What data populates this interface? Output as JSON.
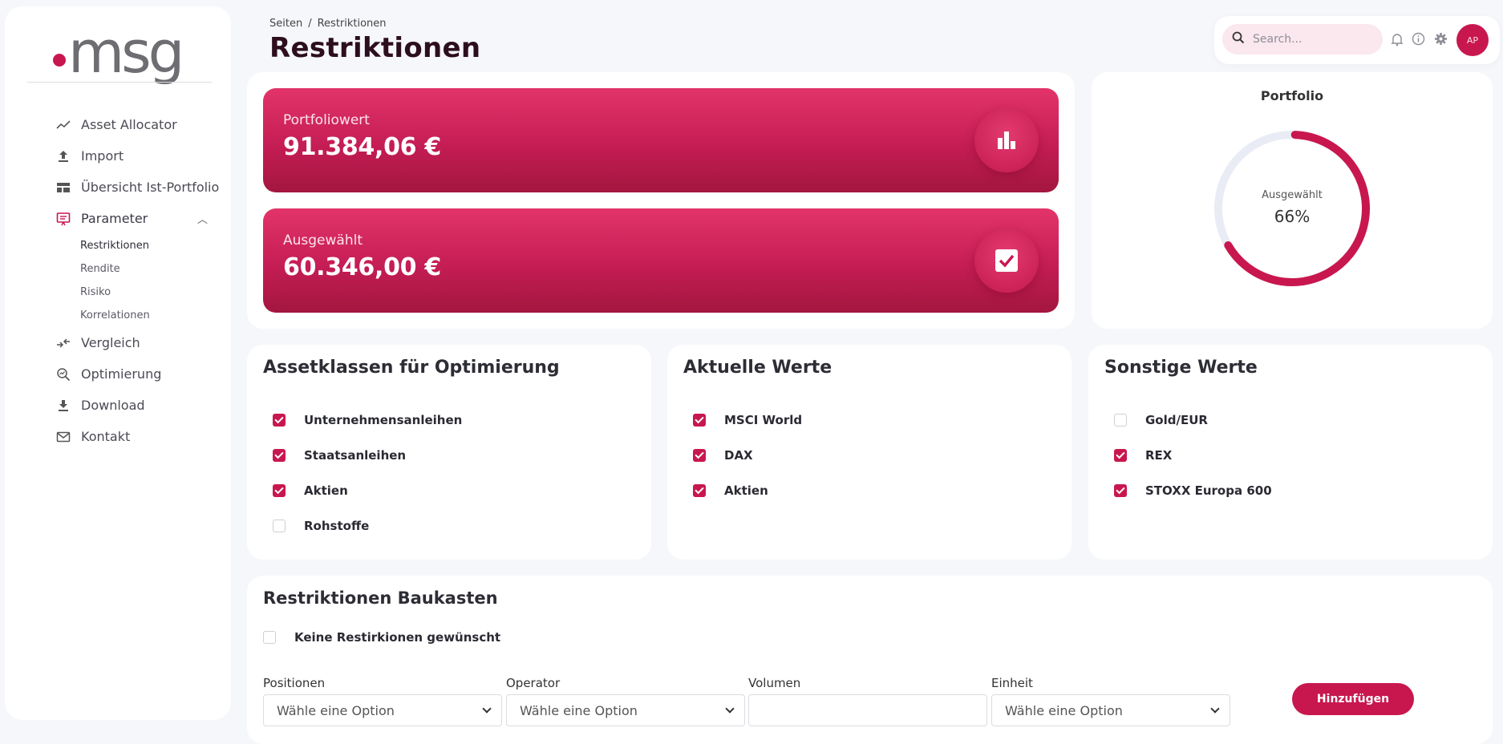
{
  "logo": {
    "text": "msg"
  },
  "sidebar": {
    "items": [
      {
        "label": "Asset Allocator",
        "icon": "trend-line-icon"
      },
      {
        "label": "Import",
        "icon": "upload-icon"
      },
      {
        "label": "Übersicht Ist-Portfolio",
        "icon": "dashboard-icon"
      },
      {
        "label": "Parameter",
        "icon": "presentation-icon",
        "expanded": true
      },
      {
        "label": "Vergleich",
        "icon": "compare-arrows-icon"
      },
      {
        "label": "Optimierung",
        "icon": "search-analytics-icon"
      },
      {
        "label": "Download",
        "icon": "download-icon"
      },
      {
        "label": "Kontakt",
        "icon": "mail-icon"
      }
    ],
    "subitems": [
      {
        "label": "Restriktionen",
        "active": true
      },
      {
        "label": "Rendite"
      },
      {
        "label": "Risiko"
      },
      {
        "label": "Korrelationen"
      }
    ]
  },
  "breadcrumb": {
    "root": "Seiten",
    "separator": "/",
    "current": "Restriktionen"
  },
  "page_title": "Restriktionen",
  "topbar": {
    "search_placeholder": "Search...",
    "avatar_initials": "AP",
    "icons": [
      "bell-icon",
      "info-icon",
      "gear-icon"
    ]
  },
  "kpis": [
    {
      "label": "Portfoliowert",
      "value": "91.384,06 €",
      "icon": "bar-chart-icon"
    },
    {
      "label": "Ausgewählt",
      "value": "60.346,00 €",
      "icon": "checkbox-icon"
    }
  ],
  "donut": {
    "title": "Portfolio",
    "label": "Ausgewählt",
    "value": "66%",
    "fraction": 0.66,
    "color": "#c8174f",
    "track_color": "#e9ecf5"
  },
  "cards": [
    {
      "title": "Assetklassen für Optimierung",
      "items": [
        {
          "label": "Unternehmensanleihen",
          "checked": true
        },
        {
          "label": "Staatsanleihen",
          "checked": true
        },
        {
          "label": "Aktien",
          "checked": true
        },
        {
          "label": "Rohstoffe",
          "checked": false
        }
      ]
    },
    {
      "title": "Aktuelle Werte",
      "items": [
        {
          "label": "MSCI World",
          "checked": true
        },
        {
          "label": "DAX",
          "checked": true
        },
        {
          "label": "Aktien",
          "checked": true
        }
      ]
    },
    {
      "title": "Sonstige Werte",
      "items": [
        {
          "label": "Gold/EUR",
          "checked": false
        },
        {
          "label": "REX",
          "checked": true
        },
        {
          "label": "STOXX Europa 600",
          "checked": true
        }
      ]
    }
  ],
  "baukasten": {
    "title": "Restriktionen Baukasten",
    "no_restrictions_label": "Keine Restirkionen gewünscht",
    "no_restrictions_checked": false,
    "fields": {
      "positionen": {
        "label": "Positionen",
        "value": "Wähle eine Option"
      },
      "operator": {
        "label": "Operator",
        "value": "Wähle eine Option"
      },
      "volumen": {
        "label": "Volumen",
        "value": ""
      },
      "einheit": {
        "label": "Einheit",
        "value": "Wähle eine Option"
      }
    },
    "add_button": "Hinzufügen"
  },
  "colors": {
    "accent": "#c8174f",
    "title": "#2c0e1d"
  }
}
